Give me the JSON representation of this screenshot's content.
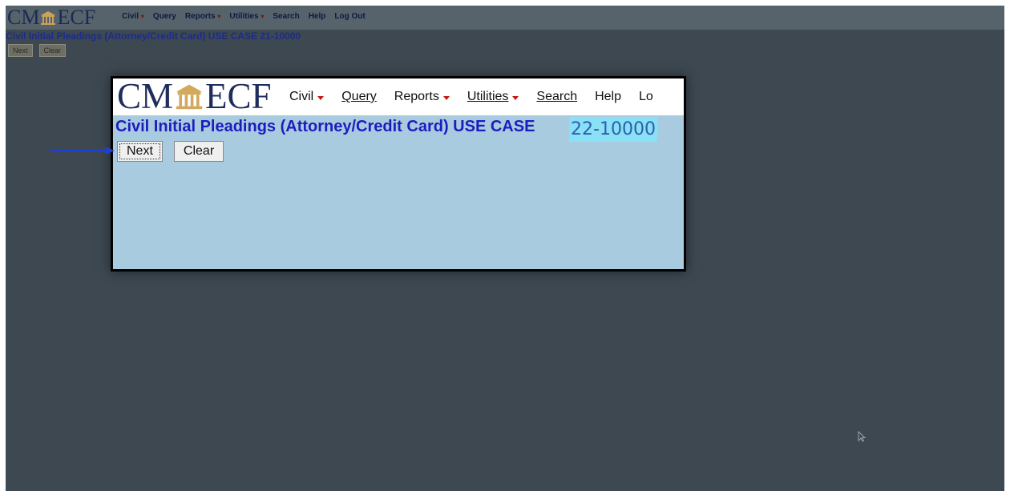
{
  "background": {
    "logo": {
      "left": "CM",
      "right": "ECF"
    },
    "menu": [
      {
        "label": "Civil",
        "dropdown": true
      },
      {
        "label": "Query",
        "dropdown": false
      },
      {
        "label": "Reports",
        "dropdown": true
      },
      {
        "label": "Utilities",
        "dropdown": true
      },
      {
        "label": "Search",
        "dropdown": false
      },
      {
        "label": "Help",
        "dropdown": false
      },
      {
        "label": "Log Out",
        "dropdown": false
      }
    ],
    "title": "Civil Initial Pleadings (Attorney/Credit Card) USE CASE 21-10000",
    "buttons": {
      "next": "Next",
      "clear": "Clear"
    }
  },
  "inset": {
    "logo": {
      "left": "CM",
      "right": "ECF"
    },
    "menu": [
      {
        "label": "Civil",
        "dropdown": true
      },
      {
        "label": "Query",
        "dropdown": false
      },
      {
        "label": "Reports",
        "dropdown": true
      },
      {
        "label": "Utilities",
        "dropdown": true
      },
      {
        "label": "Search",
        "dropdown": false
      },
      {
        "label": "Help",
        "dropdown": false
      },
      {
        "label": "Lo",
        "dropdown": false
      }
    ],
    "title": "Civil Initial Pleadings (Attorney/Credit Card) USE CASE",
    "case_number": "22-10000",
    "buttons": {
      "next": "Next",
      "clear": "Clear"
    }
  },
  "colors": {
    "desktop": "#3d4851",
    "inset_body": "#a9cbe0",
    "title": "#1d1dbf",
    "highlight": "#8ae0f4",
    "arrow": "#1f3fd4",
    "caret": "#c41a10"
  }
}
